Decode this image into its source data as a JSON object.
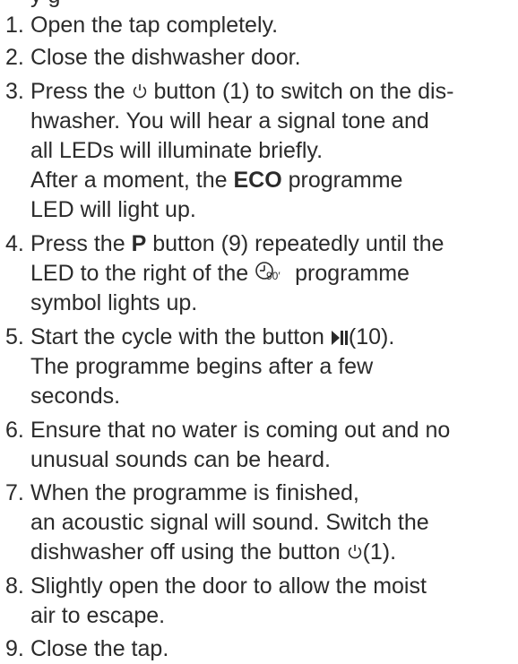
{
  "header_partial": "y                          g",
  "steps": [
    {
      "num": "1.",
      "lines": [
        {
          "t": "Open the tap completely."
        }
      ]
    },
    {
      "num": "2.",
      "lines": [
        {
          "t": "Close the dishwasher door."
        }
      ]
    },
    {
      "num": "3.",
      "lines": [
        {
          "pre": "Press the",
          "post": "button (1) to switch on the dis-"
        },
        {
          "t": "hwasher. You will hear a signal tone and"
        },
        {
          "t": "all LEDs will illuminate briefly."
        },
        {
          "pre": "After a moment, the",
          "bold": "ECO",
          "post": "programme"
        },
        {
          "t": "LED will light up."
        }
      ]
    },
    {
      "num": "4.",
      "lines": [
        {
          "pre": "Press the",
          "bold": "P",
          "post": "button (9) repeatedly until the"
        },
        {
          "pre": "LED to the right of the",
          "post": "programme"
        },
        {
          "t": "symbol lights up."
        }
      ]
    },
    {
      "num": "5.",
      "lines": [
        {
          "pre": "Start the cycle with the button",
          "post": "(10)."
        },
        {
          "t": "The programme begins after a few"
        },
        {
          "t": "seconds."
        }
      ]
    },
    {
      "num": "6.",
      "lines": [
        {
          "t": "Ensure that no water is coming out and no"
        },
        {
          "t": "unusual sounds can be heard."
        }
      ]
    },
    {
      "num": "7.",
      "lines": [
        {
          "t": "When the programme is finished,"
        },
        {
          "t": "an acoustic signal will sound. Switch the"
        },
        {
          "pre": "dishwasher off using the button",
          "post": "(1)."
        }
      ]
    },
    {
      "num": "8.",
      "lines": [
        {
          "t": "Slightly open the door to allow the moist"
        },
        {
          "t": "air to escape."
        }
      ]
    },
    {
      "num": "9.",
      "lines": [
        {
          "t": "Close the tap."
        }
      ]
    }
  ],
  "icons": {
    "power": "power-icon",
    "programme_90": "programme-90-min-icon",
    "start_pause": "start-pause-icon"
  },
  "colors": {
    "text": "#2b2b2b"
  }
}
